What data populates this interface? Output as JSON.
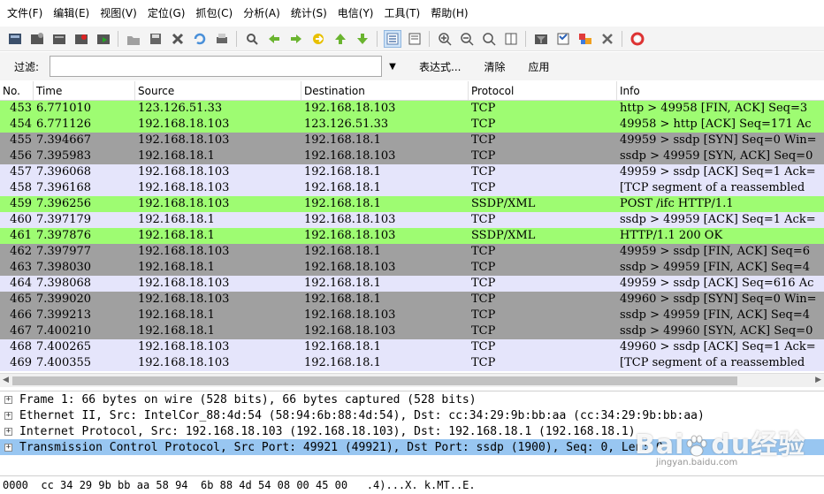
{
  "menu": [
    "文件(F)",
    "编辑(E)",
    "视图(V)",
    "定位(G)",
    "抓包(C)",
    "分析(A)",
    "统计(S)",
    "电信(Y)",
    "工具(T)",
    "帮助(H)"
  ],
  "toolbar_icons": [
    {
      "name": "interface-list-icon",
      "sep_after": false
    },
    {
      "name": "capture-options-icon",
      "sep_after": false
    },
    {
      "name": "start-capture-icon",
      "sep_after": false
    },
    {
      "name": "stop-capture-icon",
      "sep_after": false
    },
    {
      "name": "restart-capture-icon",
      "sep_after": true
    },
    {
      "name": "open-file-icon",
      "sep_after": false
    },
    {
      "name": "save-file-icon",
      "sep_after": false
    },
    {
      "name": "close-file-icon",
      "sep_after": false
    },
    {
      "name": "reload-icon",
      "sep_after": false
    },
    {
      "name": "print-icon",
      "sep_after": true
    },
    {
      "name": "find-packet-icon",
      "sep_after": false
    },
    {
      "name": "go-back-icon",
      "sep_after": false
    },
    {
      "name": "go-forward-icon",
      "sep_after": false
    },
    {
      "name": "go-to-packet-icon",
      "sep_after": false
    },
    {
      "name": "go-first-icon",
      "sep_after": false
    },
    {
      "name": "go-last-icon",
      "sep_after": true
    },
    {
      "name": "colorize-icon",
      "sep_after": false,
      "selected": true
    },
    {
      "name": "auto-scroll-icon",
      "sep_after": true
    },
    {
      "name": "zoom-in-icon",
      "sep_after": false
    },
    {
      "name": "zoom-out-icon",
      "sep_after": false
    },
    {
      "name": "zoom-normal-icon",
      "sep_after": false
    },
    {
      "name": "resize-columns-icon",
      "sep_after": true
    },
    {
      "name": "capture-filters-icon",
      "sep_after": false
    },
    {
      "name": "display-filters-icon",
      "sep_after": false
    },
    {
      "name": "coloring-rules-icon",
      "sep_after": false
    },
    {
      "name": "preferences-icon",
      "sep_after": true
    },
    {
      "name": "help-icon",
      "sep_after": false
    }
  ],
  "filter": {
    "label": "过滤:",
    "value": "",
    "placeholder": "",
    "expression_label": "表达式...",
    "clear_label": "清除",
    "apply_label": "应用"
  },
  "columns": {
    "no": "No.",
    "time": "Time",
    "source": "Source",
    "destination": "Destination",
    "protocol": "Protocol",
    "info": "Info"
  },
  "row_colors": {
    "green": "#9efc72",
    "gray": "#a0a0a0",
    "lavender": "#e5e5fb"
  },
  "packets": [
    {
      "no": "453",
      "time": "6.771010",
      "src": "123.126.51.33",
      "dst": "192.168.18.103",
      "proto": "TCP",
      "info": "http > 49958 [FIN, ACK] Seq=3",
      "color": "green"
    },
    {
      "no": "454",
      "time": "6.771126",
      "src": "192.168.18.103",
      "dst": "123.126.51.33",
      "proto": "TCP",
      "info": "49958 > http [ACK] Seq=171 Ac",
      "color": "green"
    },
    {
      "no": "455",
      "time": "7.394667",
      "src": "192.168.18.103",
      "dst": "192.168.18.1",
      "proto": "TCP",
      "info": "49959 > ssdp [SYN] Seq=0 Win=",
      "color": "gray"
    },
    {
      "no": "456",
      "time": "7.395983",
      "src": "192.168.18.1",
      "dst": "192.168.18.103",
      "proto": "TCP",
      "info": "ssdp > 49959 [SYN, ACK] Seq=0",
      "color": "gray"
    },
    {
      "no": "457",
      "time": "7.396068",
      "src": "192.168.18.103",
      "dst": "192.168.18.1",
      "proto": "TCP",
      "info": "49959 > ssdp [ACK] Seq=1 Ack=",
      "color": "lavender"
    },
    {
      "no": "458",
      "time": "7.396168",
      "src": "192.168.18.103",
      "dst": "192.168.18.1",
      "proto": "TCP",
      "info": "[TCP segment of a reassembled",
      "color": "lavender"
    },
    {
      "no": "459",
      "time": "7.396256",
      "src": "192.168.18.103",
      "dst": "192.168.18.1",
      "proto": "SSDP/XML",
      "info": "POST /ifc HTTP/1.1",
      "color": "green"
    },
    {
      "no": "460",
      "time": "7.397179",
      "src": "192.168.18.1",
      "dst": "192.168.18.103",
      "proto": "TCP",
      "info": "ssdp > 49959 [ACK] Seq=1 Ack=",
      "color": "lavender"
    },
    {
      "no": "461",
      "time": "7.397876",
      "src": "192.168.18.1",
      "dst": "192.168.18.103",
      "proto": "SSDP/XML",
      "info": "HTTP/1.1 200 OK",
      "color": "green"
    },
    {
      "no": "462",
      "time": "7.397977",
      "src": "192.168.18.103",
      "dst": "192.168.18.1",
      "proto": "TCP",
      "info": "49959 > ssdp [FIN, ACK] Seq=6",
      "color": "gray"
    },
    {
      "no": "463",
      "time": "7.398030",
      "src": "192.168.18.1",
      "dst": "192.168.18.103",
      "proto": "TCP",
      "info": "ssdp > 49959 [FIN, ACK] Seq=4",
      "color": "gray"
    },
    {
      "no": "464",
      "time": "7.398068",
      "src": "192.168.18.103",
      "dst": "192.168.18.1",
      "proto": "TCP",
      "info": "49959 > ssdp [ACK] Seq=616 Ac",
      "color": "lavender"
    },
    {
      "no": "465",
      "time": "7.399020",
      "src": "192.168.18.103",
      "dst": "192.168.18.1",
      "proto": "TCP",
      "info": "49960 > ssdp [SYN] Seq=0 Win=",
      "color": "gray"
    },
    {
      "no": "466",
      "time": "7.399213",
      "src": "192.168.18.1",
      "dst": "192.168.18.103",
      "proto": "TCP",
      "info": "ssdp > 49959 [FIN, ACK] Seq=4",
      "color": "gray"
    },
    {
      "no": "467",
      "time": "7.400210",
      "src": "192.168.18.1",
      "dst": "192.168.18.103",
      "proto": "TCP",
      "info": "ssdp > 49960 [SYN, ACK] Seq=0",
      "color": "gray"
    },
    {
      "no": "468",
      "time": "7.400265",
      "src": "192.168.18.103",
      "dst": "192.168.18.1",
      "proto": "TCP",
      "info": "49960 > ssdp [ACK] Seq=1 Ack=",
      "color": "lavender"
    },
    {
      "no": "469",
      "time": "7.400355",
      "src": "192.168.18.103",
      "dst": "192.168.18.1",
      "proto": "TCP",
      "info": "[TCP segment of a reassembled",
      "color": "lavender"
    }
  ],
  "details": [
    {
      "text": "Frame 1: 66 bytes on wire (528 bits), 66 bytes captured (528 bits)",
      "selected": false
    },
    {
      "text": "Ethernet II, Src: IntelCor_88:4d:54 (58:94:6b:88:4d:54), Dst: cc:34:29:9b:bb:aa (cc:34:29:9b:bb:aa)",
      "selected": false
    },
    {
      "text": "Internet Protocol, Src: 192.168.18.103 (192.168.18.103), Dst: 192.168.18.1 (192.168.18.1)",
      "selected": false
    },
    {
      "text": "Transmission Control Protocol, Src Port: 49921 (49921), Dst Port: ssdp (1900), Seq: 0, Len: 0",
      "selected": true
    }
  ],
  "bytes_line": "0000  cc 34 29 9b bb aa 58 94  6b 88 4d 54 08 00 45 00   .4)...X. k.MT..E.",
  "watermark": {
    "logo_a": "Bai",
    "logo_b": "du",
    "logo_c": "经验",
    "url": "jingyan.baidu.com"
  }
}
